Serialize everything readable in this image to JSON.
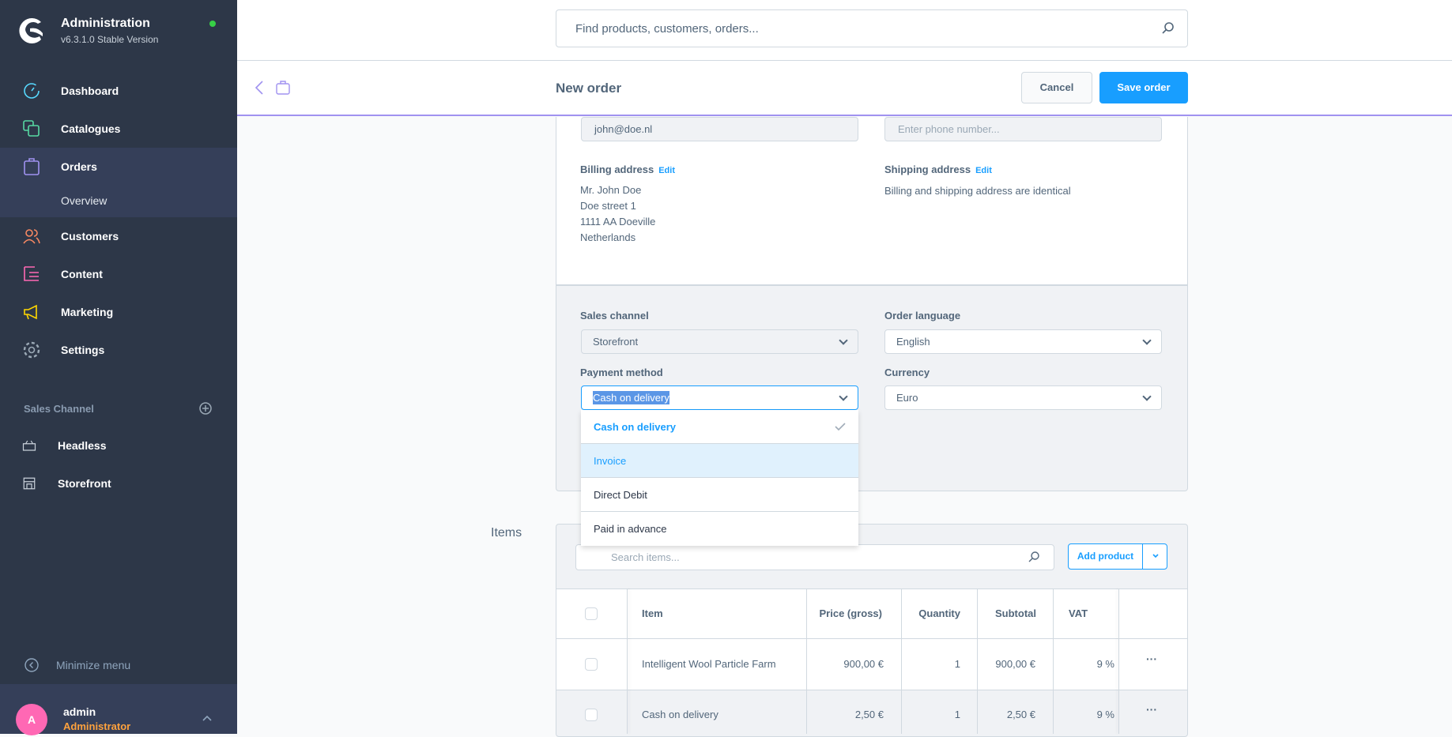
{
  "sidebar": {
    "brand_title": "Administration",
    "brand_version": "v6.3.1.0 Stable Version",
    "items": [
      {
        "label": "Dashboard",
        "icon": "gauge-icon",
        "color": "#57d9ff"
      },
      {
        "label": "Catalogues",
        "icon": "products-icon",
        "color": "#57d9a3"
      },
      {
        "label": "Orders",
        "icon": "shopping-bag-icon",
        "color": "#a092f0"
      },
      {
        "label": "Customers",
        "icon": "users-icon",
        "color": "#f88962"
      },
      {
        "label": "Content",
        "icon": "content-icon",
        "color": "#ff68b4"
      },
      {
        "label": "Marketing",
        "icon": "megaphone-icon",
        "color": "#ffd700"
      },
      {
        "label": "Settings",
        "icon": "gear-icon",
        "color": "#9aa8b5"
      }
    ],
    "orders_sub": "Overview",
    "sales_channel_title": "Sales Channel",
    "sales_channels": [
      {
        "label": "Headless",
        "icon": "basket-icon"
      },
      {
        "label": "Storefront",
        "icon": "storefront-icon"
      }
    ],
    "minimize": "Minimize menu",
    "user": {
      "initial": "A",
      "name": "admin",
      "role": "Administrator"
    }
  },
  "search": {
    "placeholder": "Find products, customers, orders..."
  },
  "header": {
    "title": "New order",
    "cancel": "Cancel",
    "save": "Save order"
  },
  "customer": {
    "email": "john@doe.nl",
    "phone_placeholder": "Enter phone number...",
    "billing_label": "Billing address",
    "shipping_label": "Shipping address",
    "edit": "Edit",
    "billing_lines": [
      "Mr. John Doe",
      "Doe street 1",
      "1111 AA Doeville",
      "Netherlands"
    ],
    "shipping_text": "Billing and shipping address are identical"
  },
  "options": {
    "sales_channel_label": "Sales channel",
    "sales_channel": "Storefront",
    "language_label": "Order language",
    "language": "English",
    "payment_label": "Payment method",
    "payment": "Cash on delivery",
    "currency_label": "Currency",
    "currency": "Euro",
    "payment_options": [
      "Cash on delivery",
      "Invoice",
      "Direct Debit",
      "Paid in advance"
    ]
  },
  "items": {
    "title": "Items",
    "search_placeholder": "Search items...",
    "add_product": "Add product",
    "columns": [
      "Item",
      "Price (gross)",
      "Quantity",
      "Subtotal",
      "VAT"
    ],
    "rows": [
      {
        "item": "Intelligent Wool Particle Farm",
        "price": "900,00 €",
        "qty": "1",
        "subtotal": "900,00 €",
        "vat": "9 %"
      },
      {
        "item": "Cash on delivery",
        "price": "2,50 €",
        "qty": "1",
        "subtotal": "2,50 €",
        "vat": "9 %"
      }
    ]
  },
  "colors": {
    "accent": "#189eff",
    "sidebar": "#2d3748"
  }
}
